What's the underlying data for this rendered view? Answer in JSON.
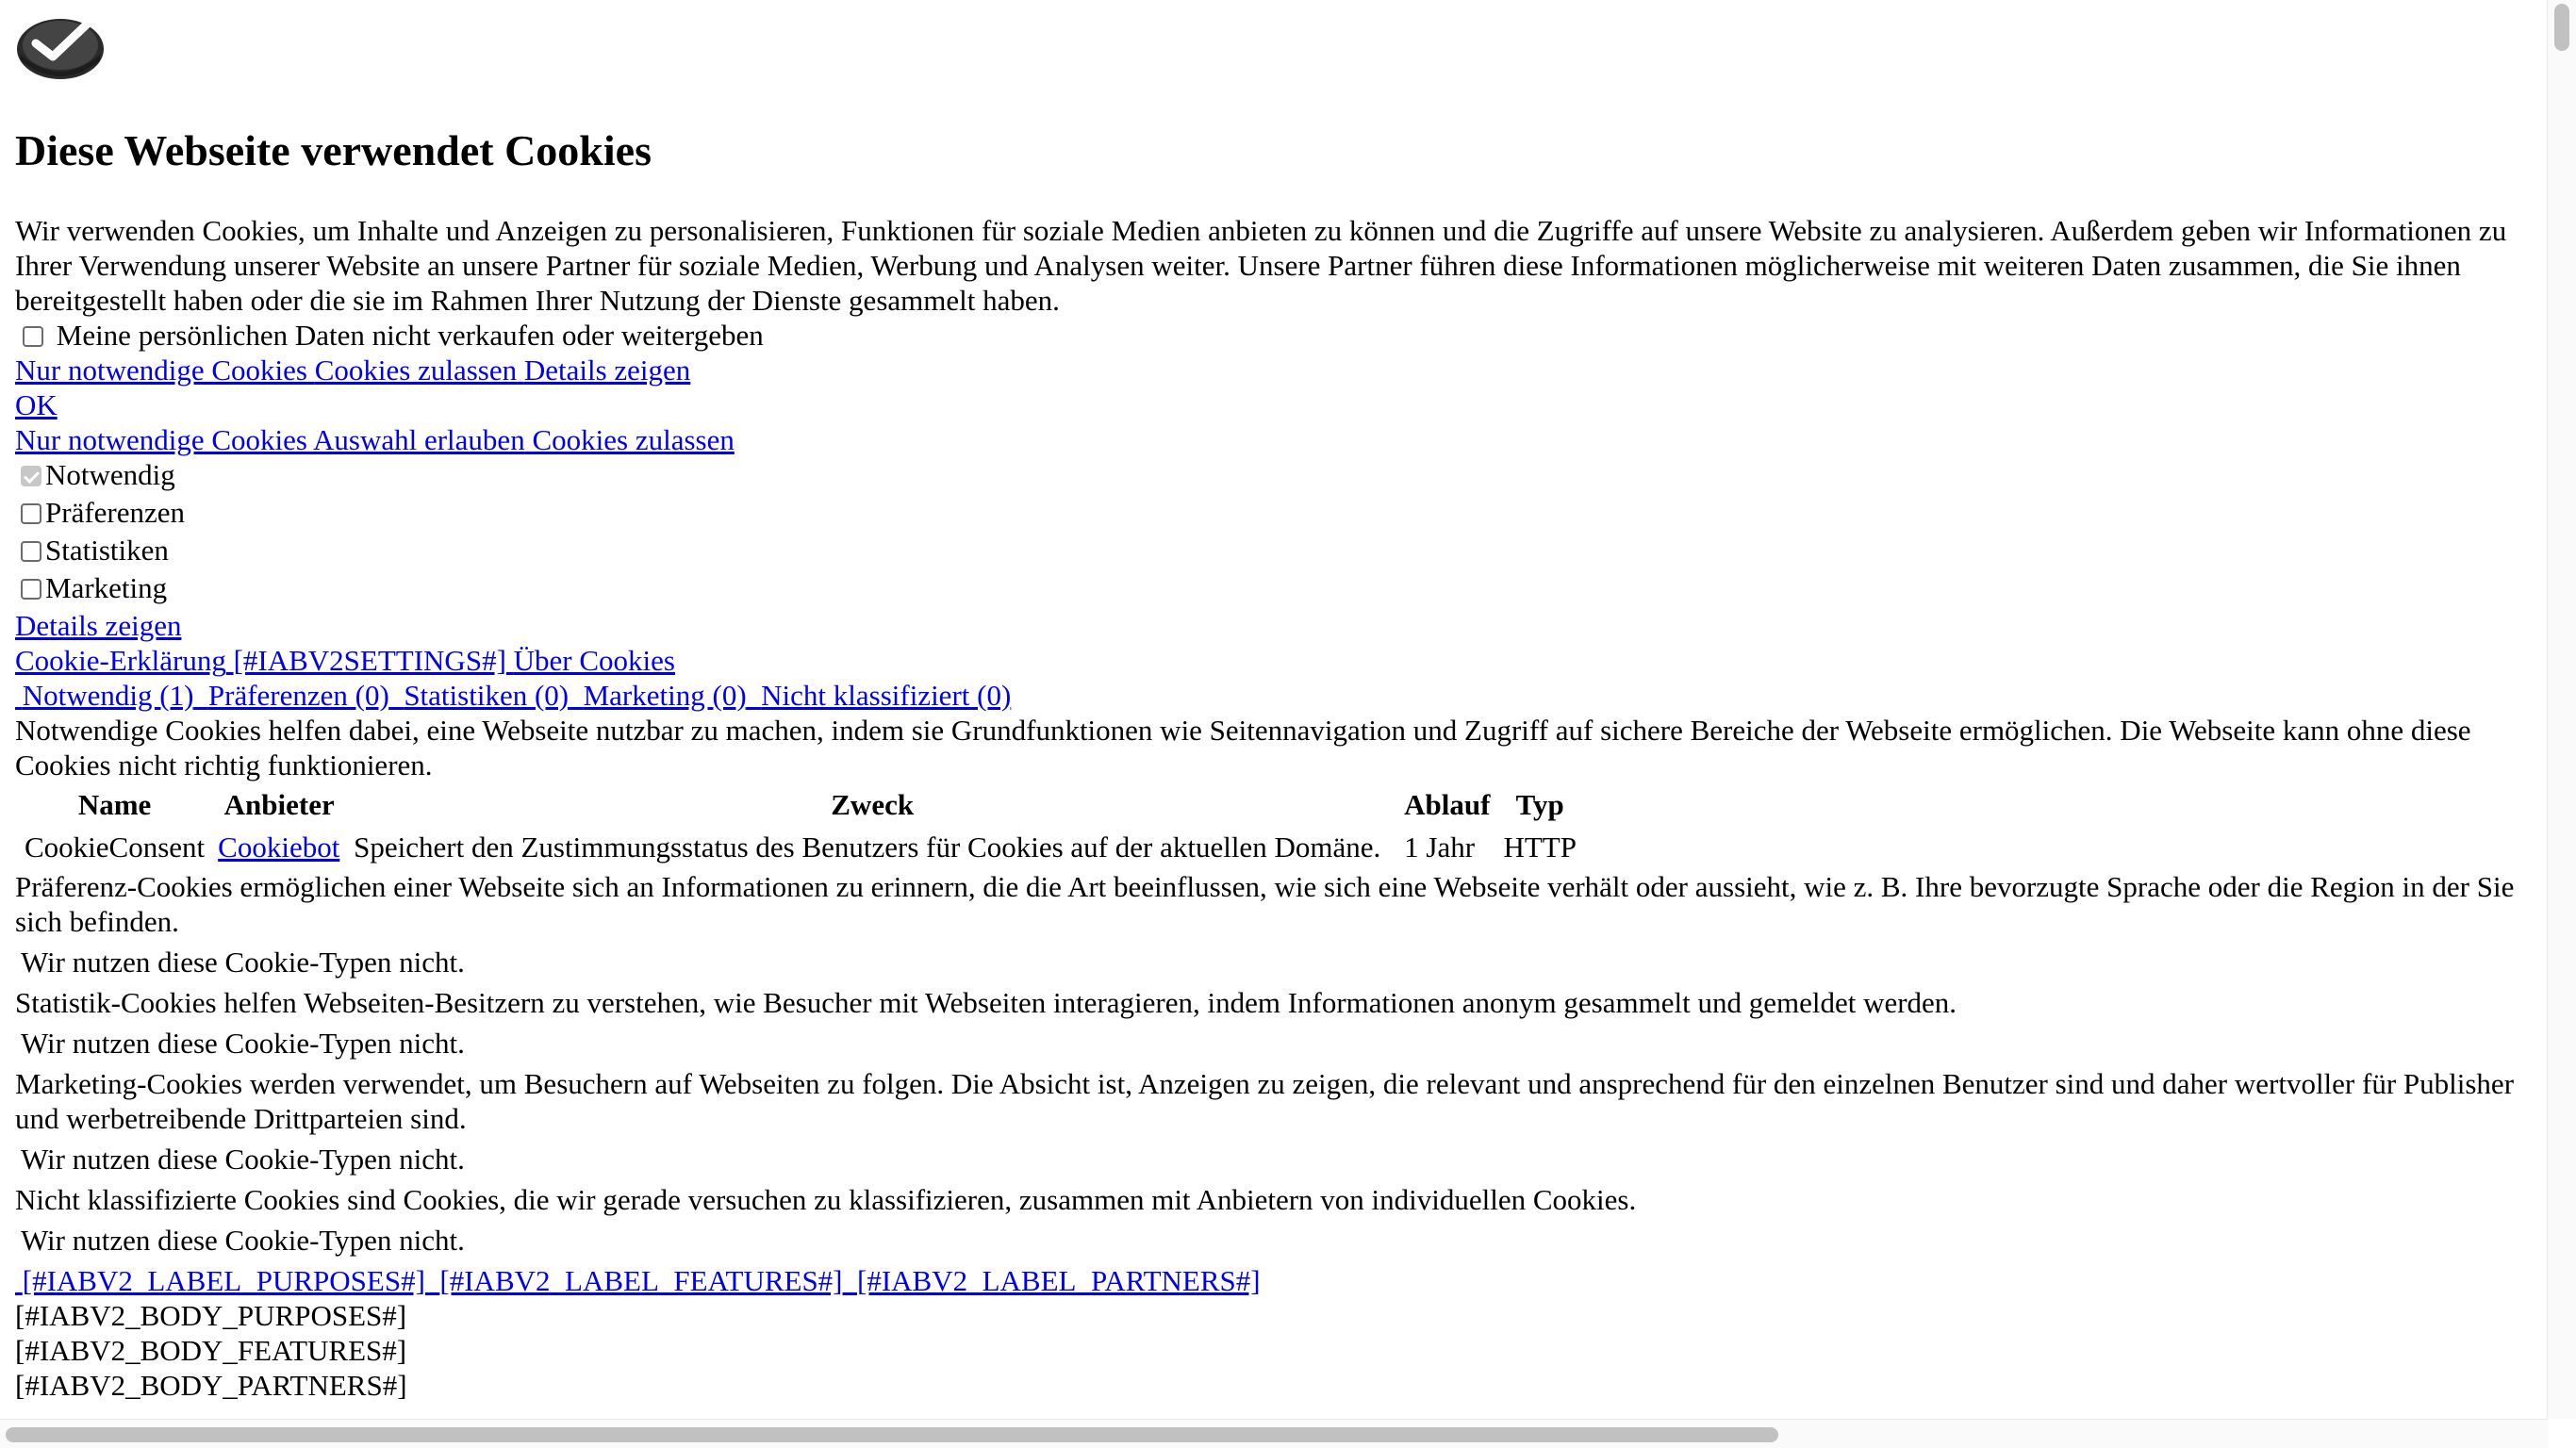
{
  "dialog": {
    "title": "Diese Webseite verwendet Cookies",
    "intro": "Wir verwenden Cookies, um Inhalte und Anzeigen zu personalisieren, Funktionen für soziale Medien anbieten zu können und die Zugriffe auf unsere Website zu analysieren. Außerdem geben wir Informationen zu Ihrer Verwendung unserer Website an unsere Partner für soziale Medien, Werbung und Analysen weiter. Unsere Partner führen diese Informationen möglicherweise mit weiteren Daten zusammen, die Sie ihnen bereitgestellt haben oder die sie im Rahmen Ihrer Nutzung der Dienste gesammelt haben.",
    "do_not_sell_label": "Meine persönlichen Daten nicht verkaufen oder weitergeben",
    "row1": {
      "necessary_only": "Nur notwendige Cookies",
      "allow_cookies": "Cookies zulassen",
      "show_details": "Details zeigen"
    },
    "ok": "OK",
    "row2": {
      "necessary_only": "Nur notwendige Cookies",
      "allow_selection": "Auswahl erlauben",
      "allow_cookies": "Cookies zulassen"
    },
    "categories": [
      {
        "label": "Notwendig",
        "checked": true,
        "disabled": true
      },
      {
        "label": "Präferenzen",
        "checked": false
      },
      {
        "label": "Statistiken",
        "checked": false
      },
      {
        "label": "Marketing",
        "checked": false
      }
    ],
    "show_details": "Details zeigen",
    "tabs": {
      "declaration": "Cookie-Erklärung",
      "iab_settings": "[#IABV2SETTINGS#]",
      "about": "Über Cookies"
    },
    "category_tabs": {
      "necessary": "Notwendig (1)",
      "preferences": "Präferenzen (0)",
      "statistics": "Statistiken (0)",
      "marketing": "Marketing (0)",
      "unclassified": "Nicht klassifiziert (0)"
    },
    "necessary_desc": "Notwendige Cookies helfen dabei, eine Webseite nutzbar zu machen, indem sie Grundfunktionen wie Seitennavigation und Zugriff auf sichere Bereiche der Webseite ermöglichen. Die Webseite kann ohne diese Cookies nicht richtig funktionieren.",
    "table": {
      "headers": {
        "name": "Name",
        "provider": "Anbieter",
        "purpose": "Zweck",
        "expiry": "Ablauf",
        "type": "Typ"
      },
      "row": {
        "name": "CookieConsent",
        "provider": "Cookiebot",
        "purpose": "Speichert den Zustimmungsstatus des Benutzers für Cookies auf der aktuellen Domäne.",
        "expiry": "1 Jahr",
        "type": "HTTP"
      }
    },
    "preferences_desc": "Präferenz-Cookies ermöglichen einer Webseite sich an Informationen zu erinnern, die die Art beeinflussen, wie sich eine Webseite verhält oder aussieht, wie z. B. Ihre bevorzugte Sprache oder die Region in der Sie sich befinden.",
    "not_used_1": "Wir nutzen diese Cookie-Typen nicht.",
    "statistics_desc": "Statistik-Cookies helfen Webseiten-Besitzern zu verstehen, wie Besucher mit Webseiten interagieren, indem Informationen anonym gesammelt und gemeldet werden.",
    "not_used_2": "Wir nutzen diese Cookie-Typen nicht.",
    "marketing_desc": "Marketing-Cookies werden verwendet, um Besuchern auf Webseiten zu folgen. Die Absicht ist, Anzeigen zu zeigen, die relevant und ansprechend für den einzelnen Benutzer sind und daher wertvoller für Publisher und werbetreibende Drittparteien sind.",
    "not_used_3": "Wir nutzen diese Cookie-Typen nicht.",
    "unclassified_desc": "Nicht klassifizierte Cookies sind Cookies, die wir gerade versuchen zu klassifizieren, zusammen mit Anbietern von individuellen Cookies.",
    "not_used_4": "Wir nutzen diese Cookie-Typen nicht.",
    "iab_labels": {
      "purposes": "[#IABV2_LABEL_PURPOSES#]",
      "features": "[#IABV2_LABEL_FEATURES#]",
      "partners": "[#IABV2_LABEL_PARTNERS#]"
    },
    "iab_bodies": {
      "purposes": "[#IABV2_BODY_PURPOSES#]",
      "features": "[#IABV2_BODY_FEATURES#]",
      "partners": "[#IABV2_BODY_PARTNERS#]"
    }
  },
  "icons": {
    "logo": "cookiebot-logo-icon"
  },
  "colors": {
    "link": "#0000EE",
    "text": "#000000",
    "background": "#FFFFFF"
  }
}
